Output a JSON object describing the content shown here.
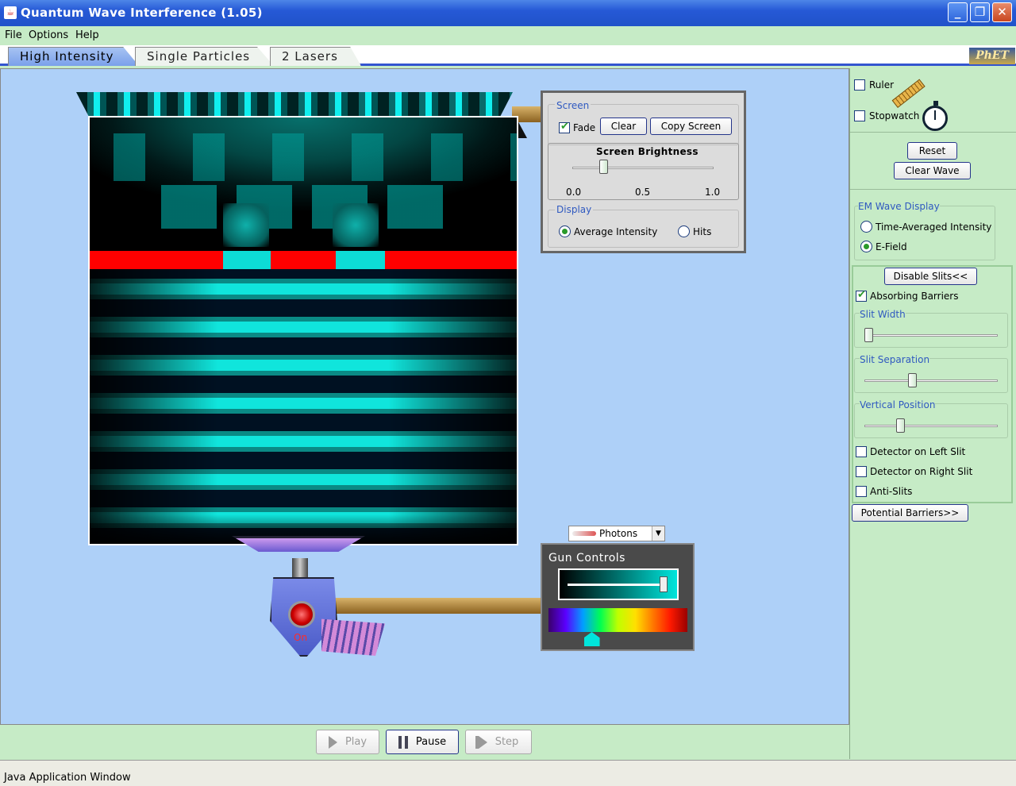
{
  "window": {
    "title": "Quantum Wave Interference (1.05)",
    "minimize": "_",
    "maximize": "❐",
    "close": "✕"
  },
  "menu": [
    "File",
    "Options",
    "Help"
  ],
  "tabs": [
    {
      "label": "High Intensity",
      "active": true
    },
    {
      "label": "Single Particles",
      "active": false
    },
    {
      "label": "2 Lasers",
      "active": false
    }
  ],
  "logo": "PhET",
  "screen_panel": {
    "group_label": "Screen",
    "fade": {
      "label": "Fade",
      "checked": true
    },
    "clear_label": "Clear",
    "copy_screen_label": "Copy Screen",
    "brightness": {
      "title": "Screen Brightness",
      "ticks": [
        "0.0",
        "0.5",
        "1.0"
      ],
      "value": 0.2
    },
    "display_label": "Display",
    "display_options": [
      {
        "label": "Average Intensity",
        "selected": true
      },
      {
        "label": "Hits",
        "selected": false
      }
    ]
  },
  "gun": {
    "particle_select": "Photons",
    "controls_title": "Gun Controls",
    "intensity": 0.95,
    "wavelength_position": 0.27,
    "on_label": "On"
  },
  "tools": {
    "ruler": {
      "label": "Ruler",
      "checked": false
    },
    "stopwatch": {
      "label": "Stopwatch",
      "checked": false
    }
  },
  "reset_label": "Reset",
  "clear_wave_label": "Clear Wave",
  "em_wave_display": {
    "label": "EM Wave Display",
    "options": [
      {
        "label": "Time-Averaged Intensity",
        "selected": false
      },
      {
        "label": "E-Field",
        "selected": true
      }
    ]
  },
  "slits": {
    "disable_label": "Disable Slits<<",
    "absorbing_barriers": {
      "label": "Absorbing Barriers",
      "checked": true
    },
    "slit_width": {
      "label": "Slit Width",
      "value": 0.0
    },
    "slit_separation": {
      "label": "Slit Separation",
      "value": 0.35
    },
    "vertical_position": {
      "label": "Vertical Position",
      "value": 0.25
    },
    "detector_left": {
      "label": "Detector on Left Slit",
      "checked": false
    },
    "detector_right": {
      "label": "Detector on Right Slit",
      "checked": false
    },
    "anti_slits": {
      "label": "Anti-Slits",
      "checked": false
    }
  },
  "potential_barriers_label": "Potential Barriers>>",
  "playback": {
    "play": "Play",
    "pause": "Pause",
    "step": "Step"
  },
  "status": "Java Application Window",
  "colors": {
    "wave": "#00e5dc",
    "barrier": "#ff0000",
    "play_area": "#aed0f8",
    "panel_bg": "#c6ebc6"
  }
}
